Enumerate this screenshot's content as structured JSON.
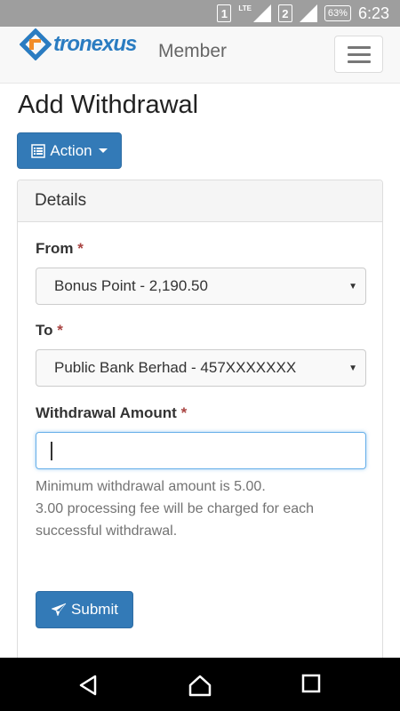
{
  "status_bar": {
    "sim1": "1",
    "network": "LTE",
    "sim2": "2",
    "battery": "63%",
    "time": "6:23"
  },
  "header": {
    "brand": "tronexus",
    "section": "Member"
  },
  "page": {
    "title": "Add Withdrawal",
    "action_label": "Action"
  },
  "panel": {
    "heading": "Details",
    "from": {
      "label": "From",
      "required_mark": "*",
      "selected": "Bonus Point - 2,190.50"
    },
    "to": {
      "label": "To",
      "required_mark": "*",
      "selected": "Public Bank Berhad - 457XXXXXXX"
    },
    "amount": {
      "label": "Withdrawal Amount",
      "required_mark": "*",
      "value": ""
    },
    "help_line1": "Minimum withdrawal amount is 5.00.",
    "help_line2": "3.00 processing fee will be charged for each successful withdrawal.",
    "submit_label": "Submit"
  },
  "colors": {
    "primary": "#337ab7",
    "brand": "#2a7cc1",
    "brand_accent": "#f28c28",
    "required": "#a94442"
  }
}
